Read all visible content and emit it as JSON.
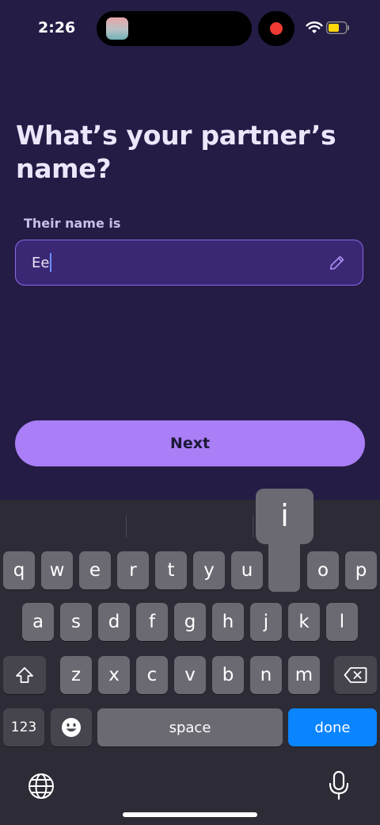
{
  "status_bar": {
    "time": "2:26"
  },
  "screen": {
    "title": "What’s your partner’s name?",
    "field_label": "Their name is",
    "field_value": "Ee",
    "next_label": "Next"
  },
  "keyboard": {
    "row1": [
      "q",
      "w",
      "e",
      "r",
      "t",
      "y",
      "u",
      "i",
      "o",
      "p"
    ],
    "row2": [
      "a",
      "s",
      "d",
      "f",
      "g",
      "h",
      "j",
      "k",
      "l"
    ],
    "row3": [
      "z",
      "x",
      "c",
      "v",
      "b",
      "n",
      "m"
    ],
    "popup_letter": "i",
    "numbers_label": "123",
    "space_label": "space",
    "done_label": "done"
  },
  "colors": {
    "background": "#241c45",
    "accent": "#a97ef6",
    "done_key": "#0a84ff"
  }
}
